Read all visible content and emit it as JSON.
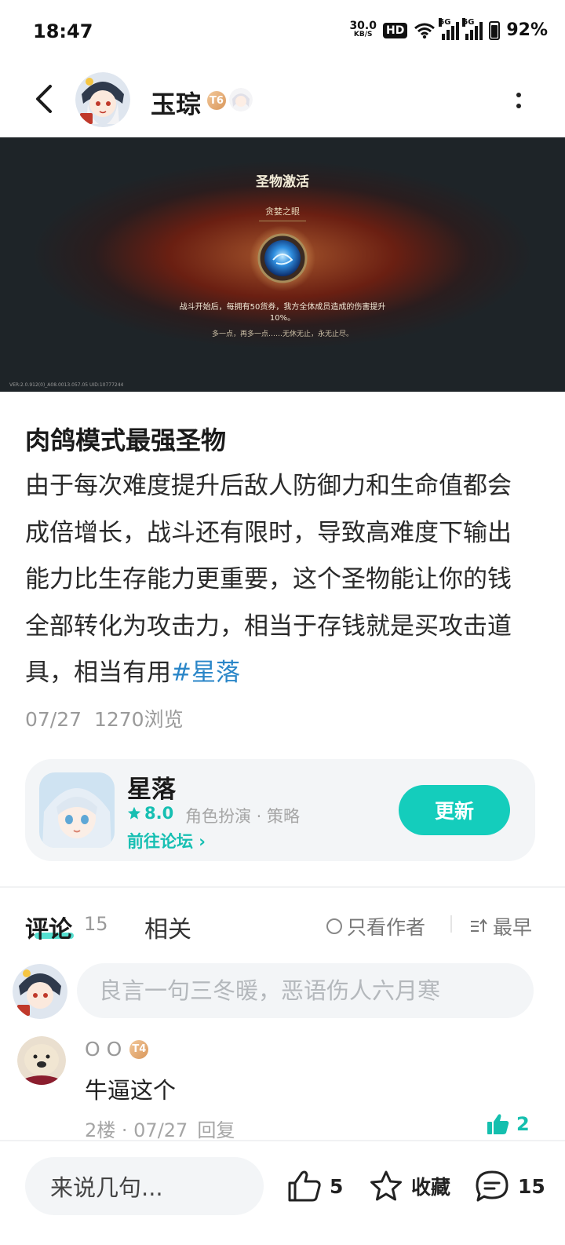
{
  "status_bar": {
    "time": "18:47",
    "net_speed": "30.0",
    "net_unit": "KB/S",
    "hd": "HD",
    "sim1": "5G",
    "sim2": "5G",
    "battery": "92%"
  },
  "header": {
    "author_name": "玉琮",
    "author_level": "T6"
  },
  "hero": {
    "title": "圣物激活",
    "subtitle": "贪婪之眼",
    "description": "战斗开始后，每拥有50货券，我方全体成员造成的伤害提升",
    "description2": "10%。",
    "flavor": "多一点，再多一点……无休无止，永无止尽。",
    "version": "VER:2.0.912(0)_A08.0013.057.05   UID:10777244"
  },
  "post": {
    "title": "肉鸽模式最强圣物",
    "body": "由于每次难度提升后敌人防御力和生命值都会成倍增长，战斗还有限时，导致高难度下输出能力比生存能力更重要，这个圣物能让你的钱全部转化为攻击力，相当于存钱就是买攻击道具，相当有用",
    "hashtag": "#星落",
    "date": "07/27",
    "views": "1270浏览"
  },
  "game_card": {
    "name": "星落",
    "rating": "8.0",
    "genre": "角色扮演 · 策略",
    "forum_link": "前往论坛 ›",
    "update_label": "更新"
  },
  "comments_section": {
    "tab_comment": "评论",
    "comment_count": "15",
    "tab_related": "相关",
    "author_only": "只看作者",
    "sort_label": "最早",
    "input_placeholder": "良言一句三冬暖，恶语伤人六月寒"
  },
  "comments": [
    {
      "name": "O O",
      "level": "T4",
      "text": "牛逼这个",
      "floor": "2楼 · 07/27",
      "reply": "回复",
      "likes": "2"
    }
  ],
  "bottom_bar": {
    "quick_comment": "来说几句...",
    "likes": "5",
    "favorite": "收藏",
    "comments": "15"
  },
  "colors": {
    "accent": "#14cdbc",
    "hashtag": "#2a86c8",
    "muted": "#9a9a9a"
  }
}
